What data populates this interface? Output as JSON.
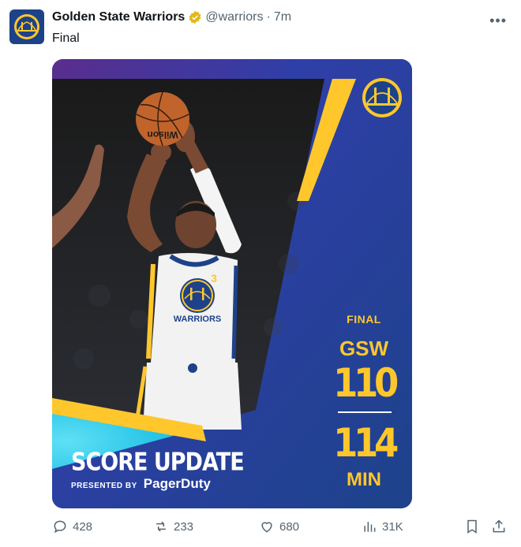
{
  "tweet": {
    "account_name": "Golden State Warriors",
    "handle": "@warriors",
    "separator": "·",
    "time": "7m",
    "text": "Final",
    "more": "•••"
  },
  "graphic": {
    "title": "SCORE UPDATE",
    "presented_by": "PRESENTED BY",
    "sponsor": "PagerDuty",
    "status": "FINAL",
    "team": "GSW",
    "score": "110",
    "time_value": "114",
    "time_unit": "MIN",
    "jersey_text": "WARRIORS",
    "jersey_number": "3",
    "ball_text": "Wilson"
  },
  "actions": {
    "replies": "428",
    "reposts": "233",
    "likes": "680",
    "views": "31K"
  },
  "colors": {
    "warriors_blue": "#1d428a",
    "warriors_gold": "#ffc72c",
    "purple": "#5b2d8e",
    "cyan": "#27c4e8",
    "verified_gold": "#e2b719"
  },
  "icons": [
    "warriors-logo-icon",
    "verified-badge-icon",
    "more-icon",
    "reply-icon",
    "repost-icon",
    "like-icon",
    "views-icon",
    "bookmark-icon",
    "share-icon"
  ]
}
